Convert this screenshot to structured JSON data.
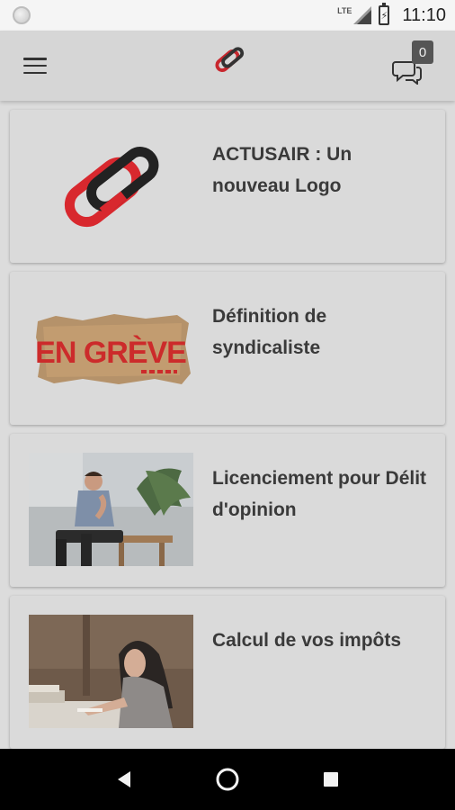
{
  "status_bar": {
    "network": "LTE",
    "time": "11:10"
  },
  "app_bar": {
    "menu_icon": "hamburger-menu-icon",
    "logo_icon": "paperclip-logo-icon",
    "chat_icon": "chat-bubbles-icon",
    "chat_count": "0"
  },
  "articles": [
    {
      "title": "ACTUSAIR : Un nouveau Logo",
      "thumbnail": "paperclip-logo"
    },
    {
      "title": "Définition de syndicaliste",
      "thumbnail": "strike-sign",
      "sign_text": "EN GRÈVE"
    },
    {
      "title": "Licenciement pour Délit d'opinion",
      "thumbnail": "worried-man-photo"
    },
    {
      "title": "Calcul de vos impôts",
      "thumbnail": "woman-writing-photo"
    }
  ],
  "nav_bar": {
    "back_icon": "back-triangle-icon",
    "home_icon": "home-circle-icon",
    "recents_icon": "recents-square-icon"
  },
  "colors": {
    "brand_red": "#d8282e",
    "brand_dark": "#222222"
  }
}
